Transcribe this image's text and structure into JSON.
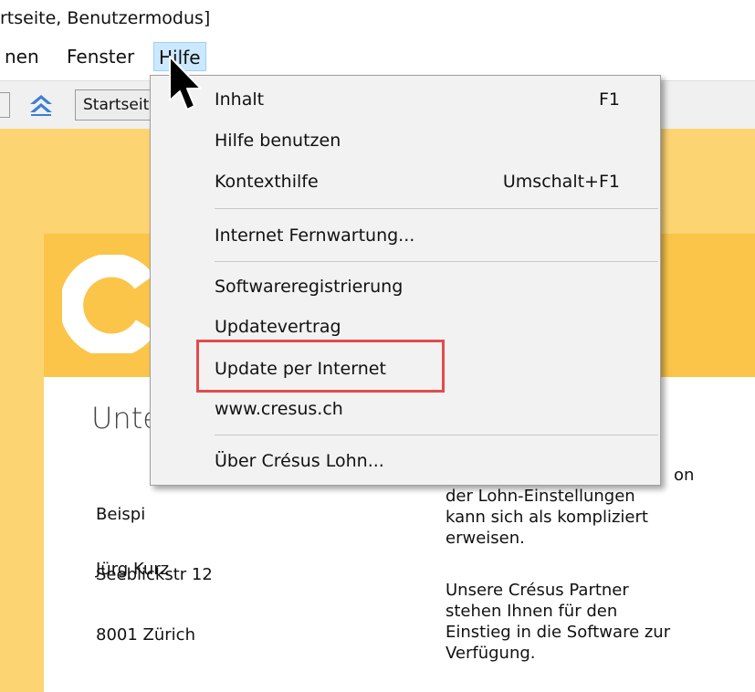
{
  "window": {
    "title_fragment": "rtseite, Benutzermodus]"
  },
  "menubar": {
    "items": [
      "nen",
      "Fenster",
      "Hilfe"
    ]
  },
  "toolbar": {
    "combo_text": "Startseite"
  },
  "menu": {
    "items": [
      {
        "label": "Inhalt",
        "shortcut": "F1"
      },
      {
        "label": "Hilfe benutzen",
        "shortcut": ""
      },
      {
        "label": "Kontexthilfe",
        "shortcut": "Umschalt+F1"
      },
      {
        "label": "Internet Fernwartung...",
        "shortcut": ""
      },
      {
        "label": "Softwareregistrierung",
        "shortcut": ""
      },
      {
        "label": "Updatevertrag",
        "shortcut": ""
      },
      {
        "label": "Update per Internet",
        "shortcut": ""
      },
      {
        "label": "www.cresus.ch",
        "shortcut": ""
      },
      {
        "label": "Über Crésus Lohn...",
        "shortcut": ""
      }
    ],
    "highlighted": "Update per Internet"
  },
  "content": {
    "heading": "Unte",
    "address_lines": [
      "Beispi",
      "Seeblickstr 12",
      "8001 Zürich"
    ],
    "contact_name": "Jürg Kurz",
    "info_lines": [
      "on",
      "der Lohn-Einstellungen",
      "kann sich als kompliziert",
      "erweisen."
    ],
    "partner_lines": [
      "Unsere Crésus Partner",
      "stehen Ihnen für den",
      "Einstieg in die Software zur",
      "Verfügung."
    ]
  },
  "colors": {
    "content_bg": "#fdd472",
    "band": "#fbc54a",
    "highlight": "#e34b4b",
    "menu_active": "#cce8ff"
  },
  "icons": [
    "toolbar-up-icon",
    "logo-g-icon",
    "mouse-cursor-icon"
  ]
}
